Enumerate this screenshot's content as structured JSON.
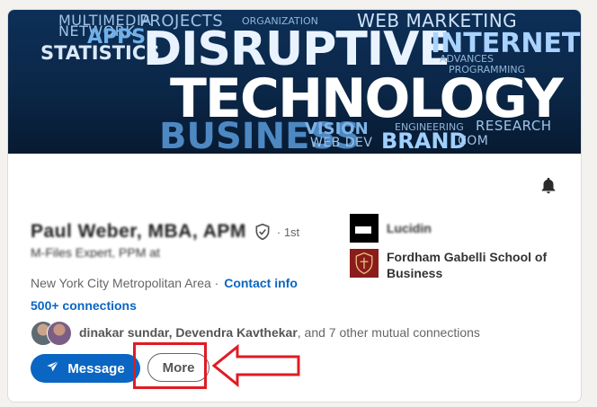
{
  "banner": {
    "words": [
      "MULTIMEDIA",
      "NETWORK",
      "PROJECTS",
      "ORGANIZATION",
      "WEB MARKETING",
      "APPS",
      "STATISTICS",
      "DISRUPTIVE",
      "INTERNET",
      "ADVANCES",
      "PROGRAMMING",
      "TECHNOLOGY",
      "BUSINESS",
      "VISION",
      "WEB DEV",
      "BRAND",
      "RESEARCH",
      "COM",
      "ENGINEERING"
    ]
  },
  "profile": {
    "name": "Paul Weber, MBA, APM",
    "degree": "· 1st",
    "headline": "M-Files Expert, PPM at",
    "location": "New York City Metropolitan Area ·",
    "contact_info": "Contact info",
    "connections": "500+ connections",
    "mutual_names": "dinakar sundar, Devendra Kavthekar",
    "mutual_rest": ", and 7 other mutual connections"
  },
  "education": [
    {
      "name": "Lucidin",
      "logo": "black-logo"
    },
    {
      "name": "Fordham Gabelli School of Business",
      "logo": "fordham-crest"
    }
  ],
  "actions": {
    "message_label": "Message",
    "more_label": "More"
  },
  "colors": {
    "primary": "#0a66c2",
    "annotation": "#e01b24"
  },
  "icons": {
    "bell": "bell-icon",
    "verified": "shield-check-icon",
    "send": "send-icon"
  }
}
